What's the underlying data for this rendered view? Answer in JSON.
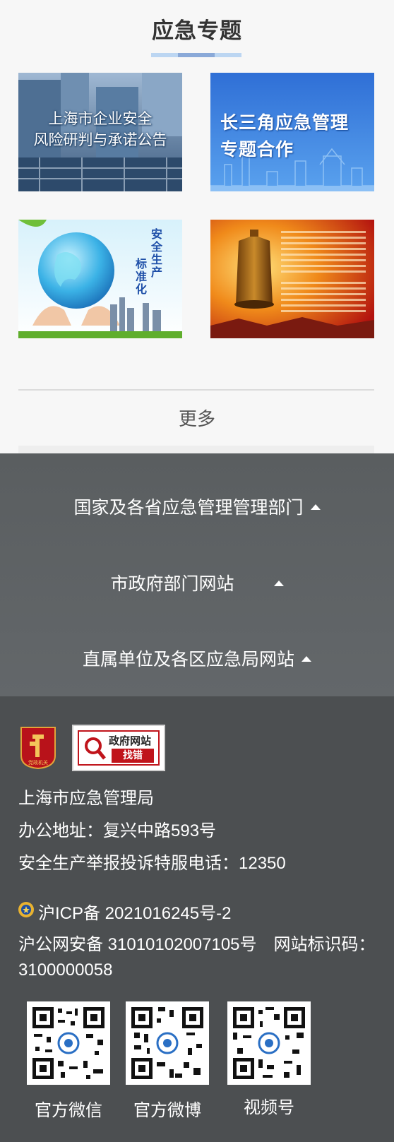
{
  "topic": {
    "title": "应急专题",
    "cards": [
      {
        "caption_lines": [
          "上海市企业安全",
          "风险研判与承诺公告"
        ]
      },
      {
        "caption_lines": [
          "长三角应急管理",
          "专题合作"
        ]
      },
      {
        "caption_a": "安全生产",
        "caption_b": "标准化"
      },
      {}
    ],
    "more_label": "更多"
  },
  "link_groups": [
    {
      "label": "国家及各省应急管理管理部门"
    },
    {
      "label": "市政府部门网站"
    },
    {
      "label": "直属单位及各区应急局网站"
    }
  ],
  "footer": {
    "party_badge_text": "党政机关",
    "gov_badge": {
      "line1": "政府网站",
      "line2": "找错"
    },
    "org_name": "上海市应急管理局",
    "address": "办公地址：复兴中路593号",
    "hotline": "安全生产举报投诉特服电话：12350",
    "icp": "沪ICP备 2021016245号-2",
    "police": "沪公网安备 31010102007105号",
    "site_id": "网站标识码：3100000058",
    "qr_codes": [
      {
        "label": "官方微信"
      },
      {
        "label": "官方微博"
      },
      {
        "label": "视频号"
      }
    ]
  },
  "colors": {
    "accent_underline": "#bcd6f2",
    "link_bg": "#5a5e60",
    "footer_bg": "#4c4f51",
    "badge_red": "#c0141b"
  }
}
